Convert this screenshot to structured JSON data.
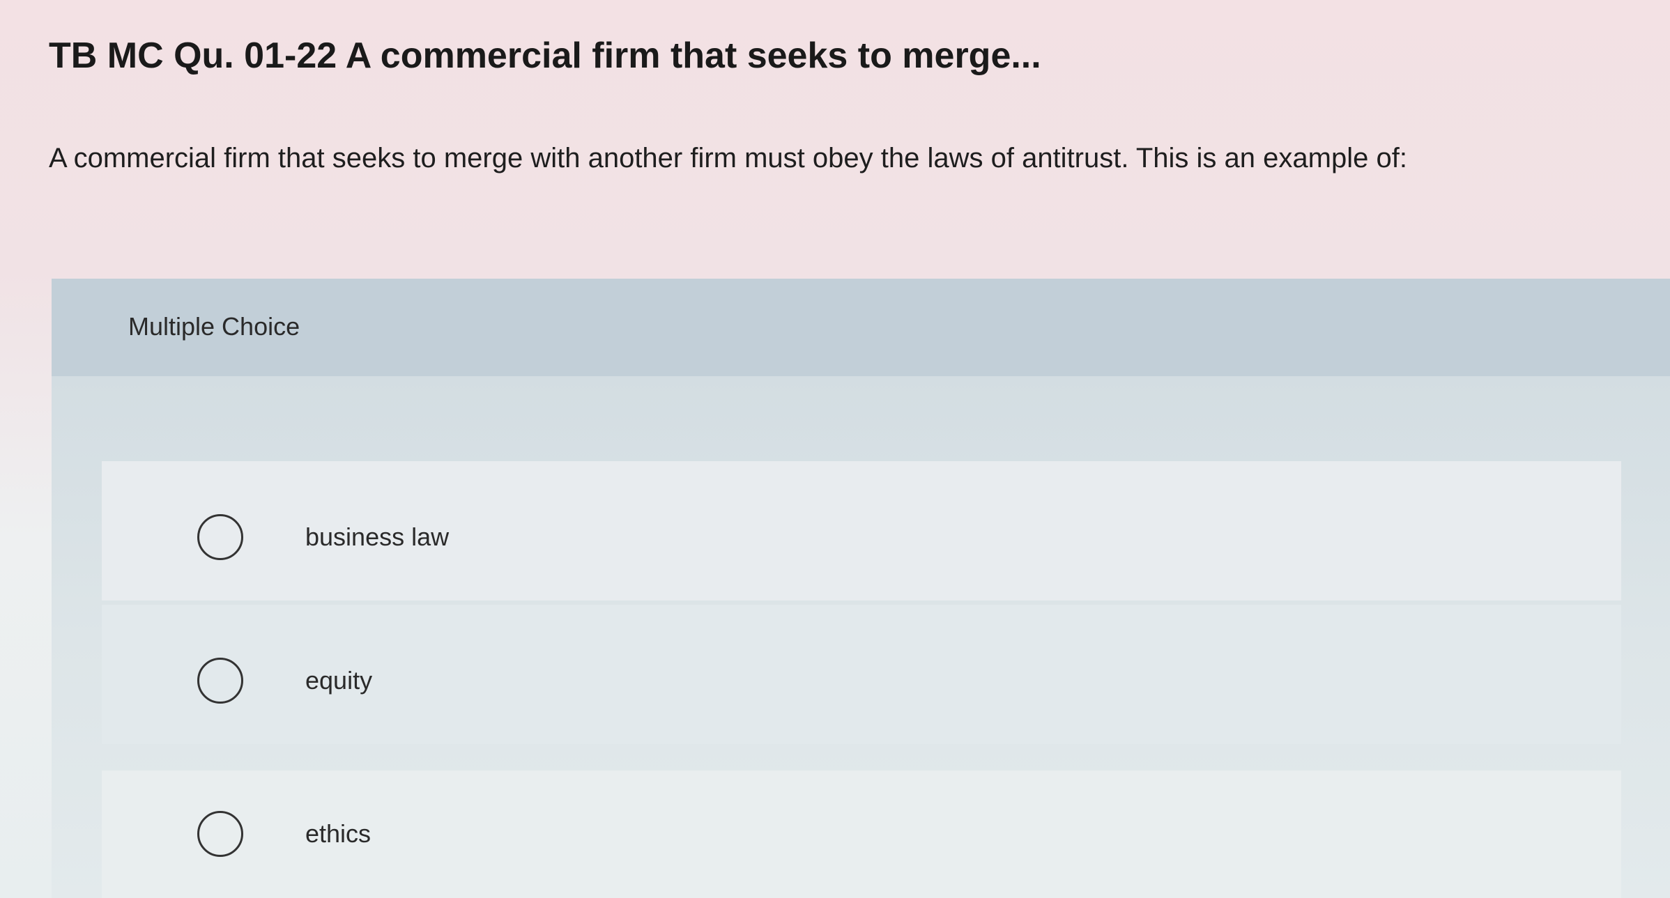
{
  "page": {
    "title": "TB MC Qu. 01-22 A commercial firm that seeks to merge...",
    "question": "A commercial firm that seeks to merge with another firm must obey the laws of antitrust. This is an example of:"
  },
  "multiple_choice": {
    "header_label": "Multiple Choice",
    "options": [
      {
        "label": "business law",
        "selected": false
      },
      {
        "label": "equity",
        "selected": false
      },
      {
        "label": "ethics",
        "selected": false
      }
    ]
  },
  "colors": {
    "panel_background": "#c9d5dc",
    "option_background": "#e6ebee",
    "text": "#1e1e1e"
  }
}
